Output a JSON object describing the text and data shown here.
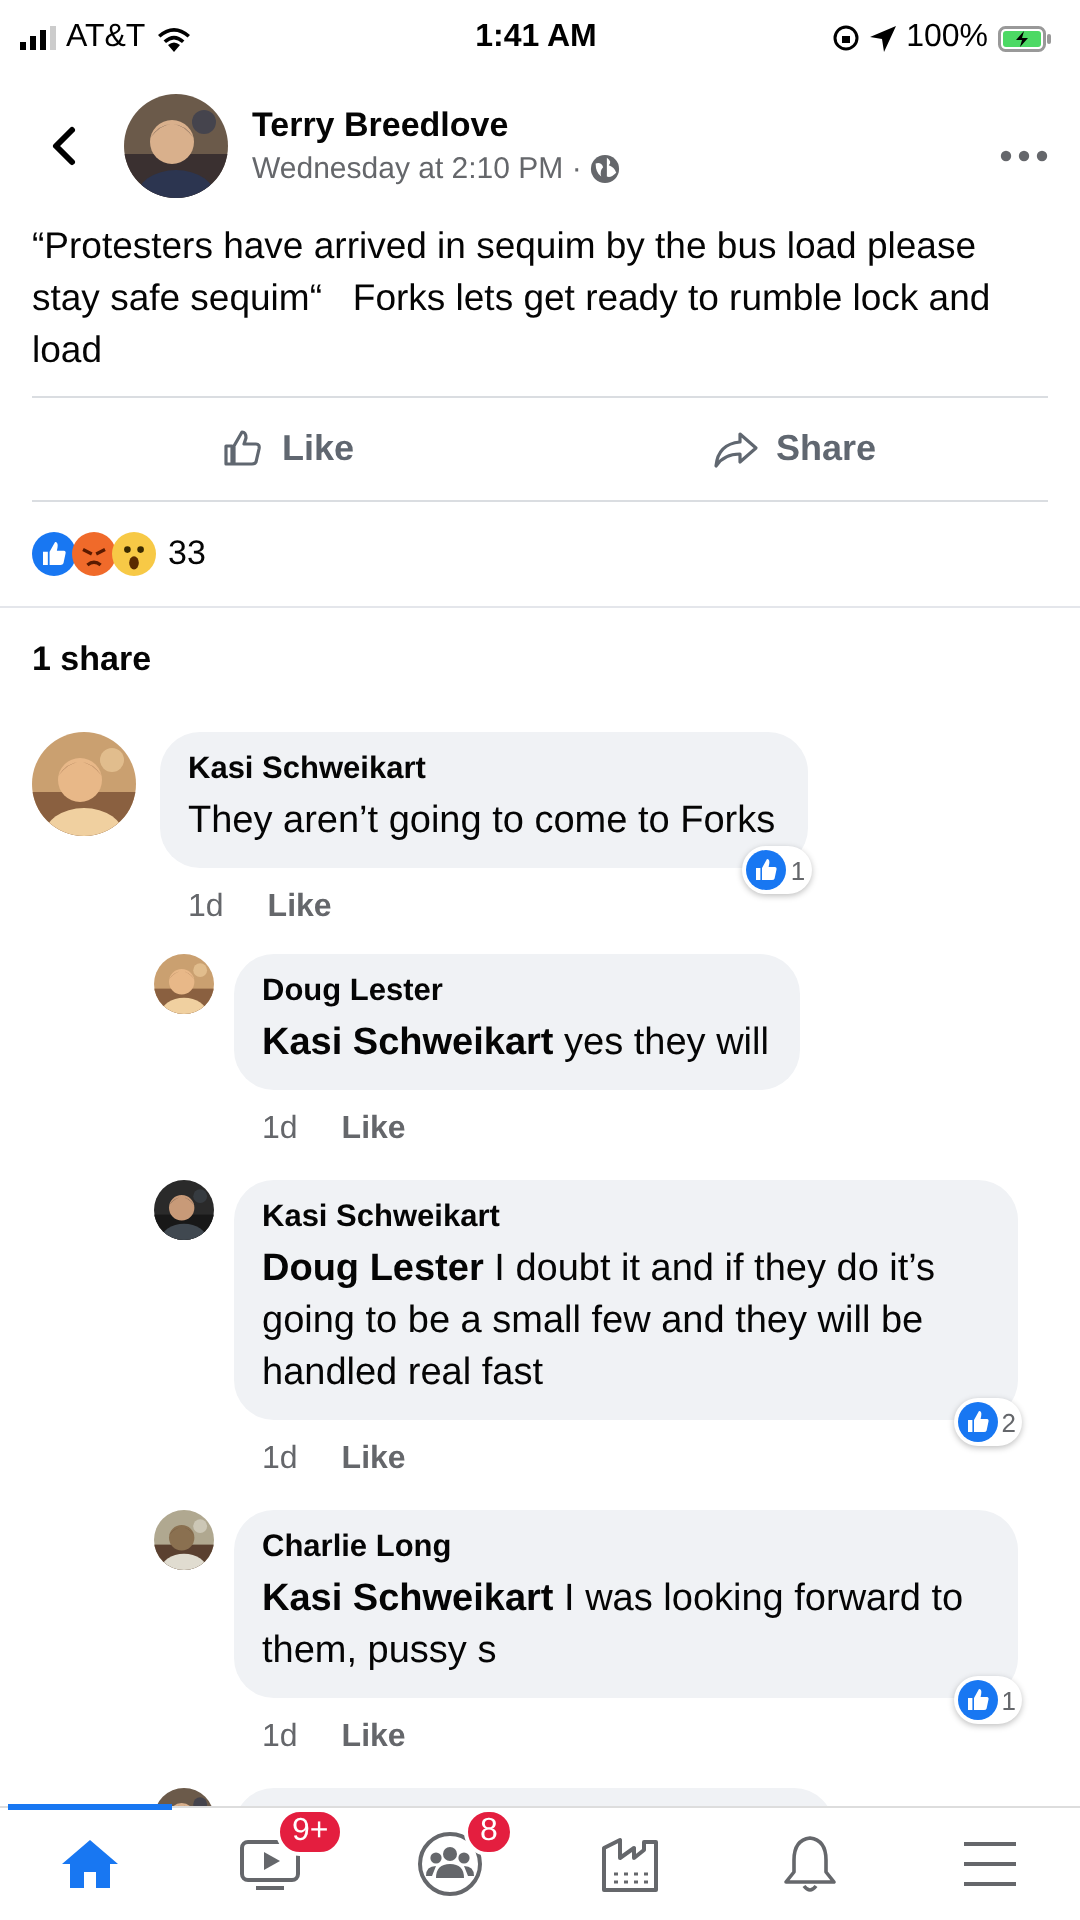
{
  "status_bar": {
    "carrier": "AT&T",
    "time": "1:41 AM",
    "battery": "100%"
  },
  "post": {
    "author": "Terry Breedlove",
    "time": "Wednesday at 2:10 PM ·",
    "text": "“Protesters have arrived in sequim by the bus load please stay safe sequim“   Forks lets get ready to rumble lock and load",
    "actions": [
      {
        "kind": "like",
        "label": "Like"
      },
      {
        "kind": "share",
        "label": "Share"
      }
    ],
    "reaction_count": "33",
    "shares": "1 share"
  },
  "comments": [
    {
      "kind": "comment",
      "name": "Kasi Schweikart",
      "text": "They aren’t going to come to Forks",
      "time": "1d",
      "like": "Like",
      "reactions": "1",
      "children": [
        {
          "kind": "comment",
          "name": "Doug Lester",
          "text": "**Kasi Schweikart** yes they will",
          "time": "1d",
          "like": "Like"
        },
        {
          "kind": "comment",
          "name": "Kasi Schweikart",
          "text": "**Doug Lester** I doubt it and if they do it’s going to be a small few and they will be handled real fast",
          "time": "1d",
          "like": "Like",
          "reactions": "2"
        },
        {
          "kind": "comment",
          "name": "Charlie Long",
          "text": "**Kasi Schweikart** I was looking forward to them, pussy s",
          "time": "1d",
          "like": "Like",
          "reactions": "1"
        },
        {
          "kind": "cut"
        }
      ]
    }
  ],
  "nav": [
    {
      "kind": "home",
      "selected": true
    },
    {
      "kind": "video",
      "selected": false,
      "badge": "9+"
    },
    {
      "kind": "groups",
      "selected": false,
      "badge": "8"
    },
    {
      "kind": "marketplace",
      "selected": false
    },
    {
      "kind": "bell",
      "selected": false
    },
    {
      "kind": "menu",
      "selected": false
    }
  ]
}
